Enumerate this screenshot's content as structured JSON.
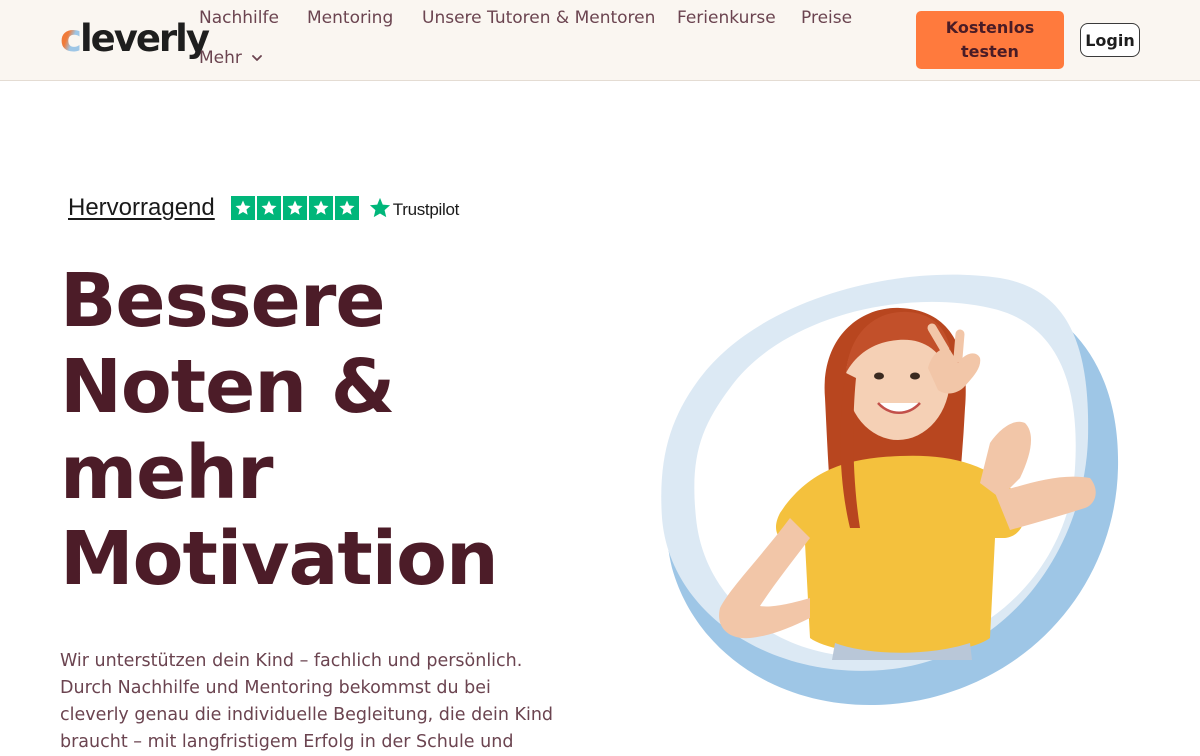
{
  "brand": {
    "logo_text_first": "c",
    "logo_text_rest": "leverly"
  },
  "nav": {
    "items": [
      "Nachhilfe",
      "Mentoring",
      "Unsere Tutoren & Mentoren",
      "Ferienkurse",
      "Preise"
    ],
    "more_label": "Mehr"
  },
  "header": {
    "trial_label": "Kostenlos testen",
    "login_label": "Login"
  },
  "trustpilot": {
    "rating_text": "Hervorragend",
    "stars": 5,
    "brand": "Trustpilot"
  },
  "hero": {
    "headline_lines": [
      "Bessere",
      "Noten &",
      "mehr",
      "Motivation"
    ],
    "intro": "Wir unterstützen dein Kind – fachlich und persönlich. Durch Nachhilfe und Mentoring bekommst du bei cleverly genau die individuelle Begleitung, die dein Kind braucht – mit langfristigem Erfolg in der Schule und"
  },
  "colors": {
    "accent": "#ff7a3d",
    "headline": "#4c1c28",
    "header_bg": "#faf6f1",
    "trustpilot_green": "#00b67a",
    "blob_blue": "#9ec6e6",
    "blob_light": "#dce9f4"
  }
}
